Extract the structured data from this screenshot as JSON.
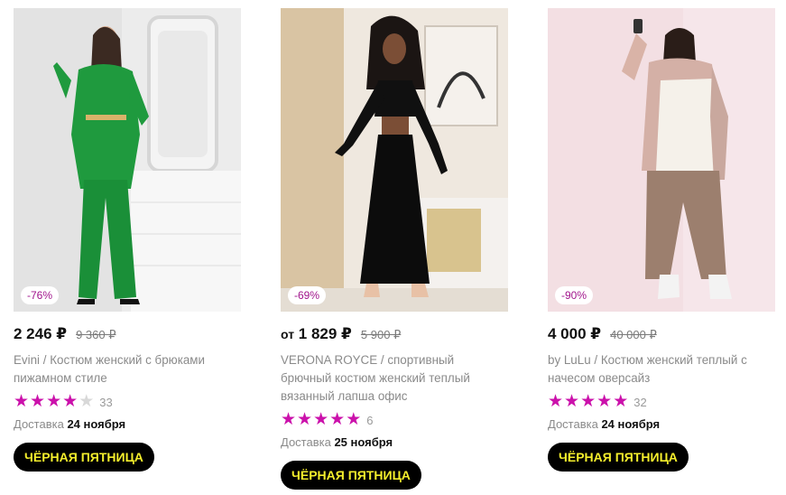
{
  "products": [
    {
      "discount": "-76%",
      "price": "2 246 ₽",
      "price_prefix": "",
      "old_price": "9 360 ₽",
      "brand": "Evini",
      "name": " / Костюм женский с брюками пижамном стиле",
      "stars": 4,
      "reviews": "33",
      "delivery_label": "Доставка",
      "delivery_date": "24 ноября",
      "promo": "ЧЁРНАЯ ПЯТНИЦА",
      "image": "woman-green-suit-photo"
    },
    {
      "discount": "-69%",
      "price": "1 829 ₽",
      "price_prefix": "от",
      "old_price": "5 900 ₽",
      "brand": "VERONA ROYCE",
      "name": " / спортивный брючный костюм женский теплый вязанный лапша офис",
      "stars": 5,
      "reviews": "6",
      "delivery_label": "Доставка",
      "delivery_date": "25 ноября",
      "promo": "ЧЁРНАЯ ПЯТНИЦА",
      "image": "woman-black-suit-photo"
    },
    {
      "discount": "-90%",
      "price": "4 000 ₽",
      "price_prefix": "",
      "old_price": "40 000 ₽",
      "brand": "by LuLu",
      "name": " / Костюм женский теплый с начесом оверсайз",
      "stars": 5,
      "reviews": "32",
      "delivery_label": "Доставка",
      "delivery_date": "24 ноября",
      "promo": "ЧЁРНАЯ ПЯТНИЦА",
      "image": "woman-beige-hoodie-photo"
    }
  ],
  "colors": {
    "accent_star": "#cb11ab",
    "discount_text": "#a1148c",
    "promo_bg": "#000000",
    "promo_text": "#f4ee2c"
  }
}
